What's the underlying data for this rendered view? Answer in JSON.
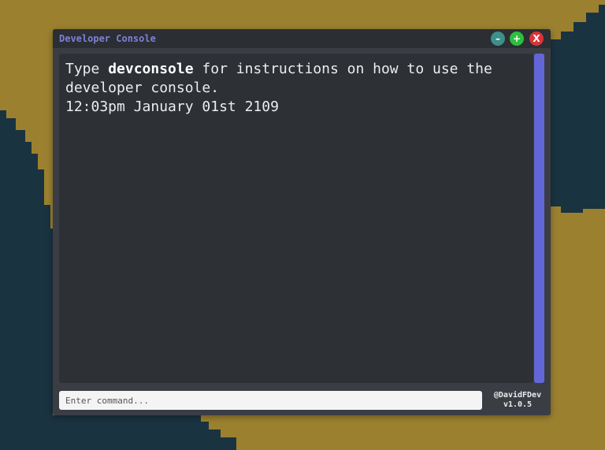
{
  "window": {
    "title": "Developer Console",
    "buttons": {
      "minimize": "–",
      "maximize": "+",
      "close": "X"
    }
  },
  "output": {
    "line1_prefix": "Type ",
    "line1_keyword": "devconsole",
    "line1_suffix": " for instructions on how to use the developer console.",
    "timestamp": "12:03pm January 01st 2109"
  },
  "command": {
    "placeholder": "Enter command..."
  },
  "credits": {
    "author": "@DavidFDev",
    "version": "v1.0.5"
  },
  "colors": {
    "title": "#7f80d8",
    "scrollbar": "#6366d6",
    "minimize": "#3d8f8c",
    "maximize": "#2cbf3e",
    "close": "#d9343a",
    "ground": "#a0862f",
    "water": "#1a3340"
  }
}
